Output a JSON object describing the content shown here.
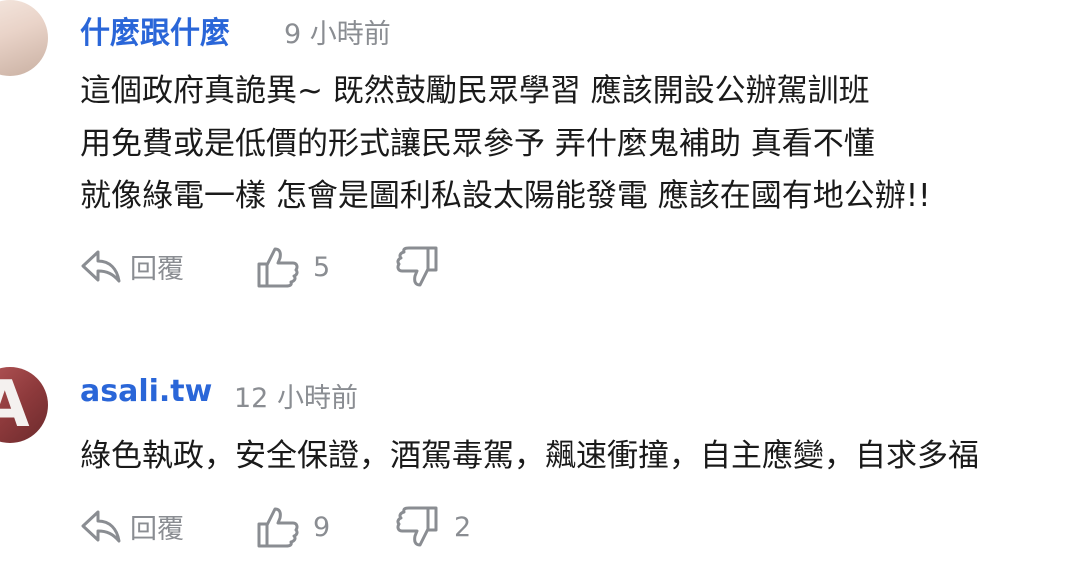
{
  "comments": [
    {
      "author": "什麼跟什麼",
      "time": "9 小時前",
      "lines": [
        "這個政府真詭異~ 既然鼓勵民眾學習 應該開設公辦駕訓班",
        "用免費或是低價的形式讓民眾參予 弄什麼鬼補助 真看不懂",
        "就像綠電一樣 怎會是圖利私設太陽能發電 應該在國有地公辦!!"
      ],
      "reply_label": "回覆",
      "likes": "5",
      "dislikes": ""
    },
    {
      "author": "asali.tw",
      "time": "12 小時前",
      "lines": [
        "綠色執政，安全保證，酒駕毒駕，飆速衝撞，自主應變，自求多福"
      ],
      "reply_label": "回覆",
      "likes": "9",
      "dislikes": "2"
    }
  ],
  "colors": {
    "author": "#2a66d8",
    "meta": "#8a8d92",
    "text": "#1a1a1a"
  },
  "icons": {
    "reply": "reply-arrow-icon",
    "like": "thumbs-up-icon",
    "dislike": "thumbs-down-icon"
  }
}
